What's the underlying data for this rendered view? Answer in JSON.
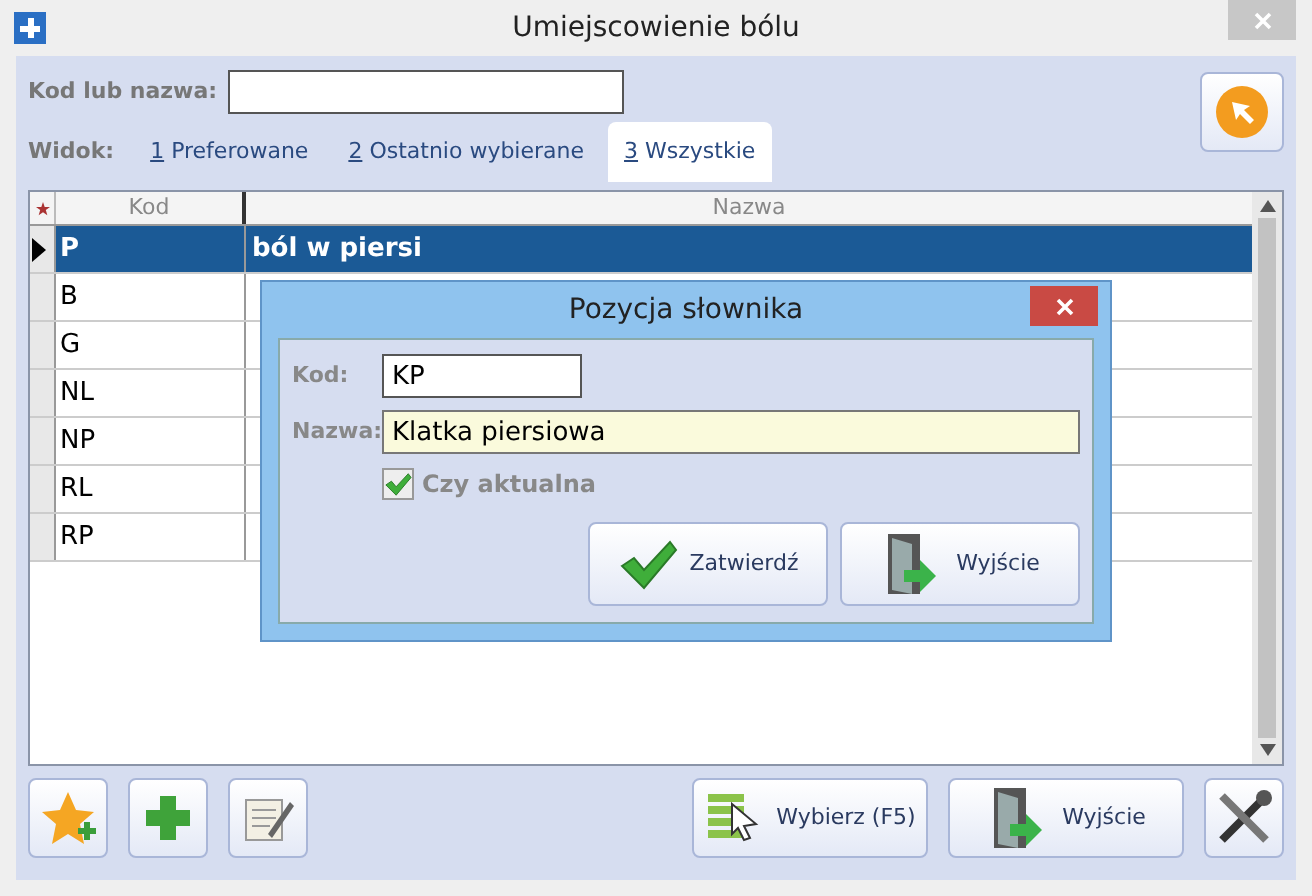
{
  "window": {
    "title": "Umiejscowienie bólu"
  },
  "search": {
    "label": "Kod lub nazwa:"
  },
  "view": {
    "label": "Widok:",
    "tabs": [
      {
        "key": "1",
        "label": "Preferowane",
        "selected": false
      },
      {
        "key": "2",
        "label": "Ostatnio wybierane",
        "selected": false
      },
      {
        "key": "3",
        "label": "Wszystkie",
        "selected": true
      }
    ]
  },
  "table": {
    "columns": [
      "Kod",
      "Nazwa"
    ],
    "rows": [
      {
        "kod": "P",
        "nazwa": "ból w piersi",
        "selected": true
      },
      {
        "kod": "B",
        "selected": false
      },
      {
        "kod": "G",
        "selected": false
      },
      {
        "kod": "NL",
        "selected": false
      },
      {
        "kod": "NP",
        "selected": false
      },
      {
        "kod": "RL",
        "selected": false
      },
      {
        "kod": "RP",
        "selected": false
      }
    ]
  },
  "dialog": {
    "title": "Pozycja słownika",
    "kod_label": "Kod:",
    "kod_value": "KP",
    "nazwa_label": "Nazwa:",
    "nazwa_value": "Klatka piersiowa",
    "checkbox": {
      "label": "Czy aktualna",
      "checked": true
    },
    "buttons": [
      "Zatwierdź",
      "Wyjście"
    ]
  },
  "footer": {
    "buttons": [
      "Wybierz (F5)",
      "Wyjście"
    ]
  }
}
